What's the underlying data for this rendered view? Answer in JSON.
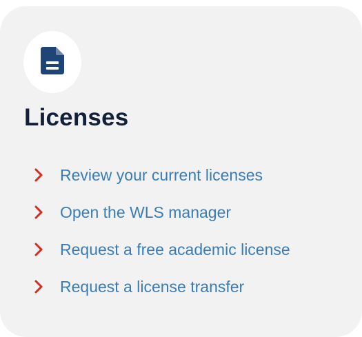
{
  "card": {
    "title": "Licenses",
    "icon": "document-icon",
    "links": [
      {
        "label": "Review your current licenses",
        "icon": "chevron-right-icon"
      },
      {
        "label": "Open the WLS manager",
        "icon": "chevron-right-icon"
      },
      {
        "label": "Request a free academic license",
        "icon": "chevron-right-icon"
      },
      {
        "label": "Request a license transfer",
        "icon": "chevron-right-icon"
      }
    ]
  },
  "colors": {
    "card_background": "#f2f2f2",
    "title": "#12203a",
    "icon": "#1e4478",
    "chevron": "#d42a20",
    "link": "#3a7db5"
  }
}
